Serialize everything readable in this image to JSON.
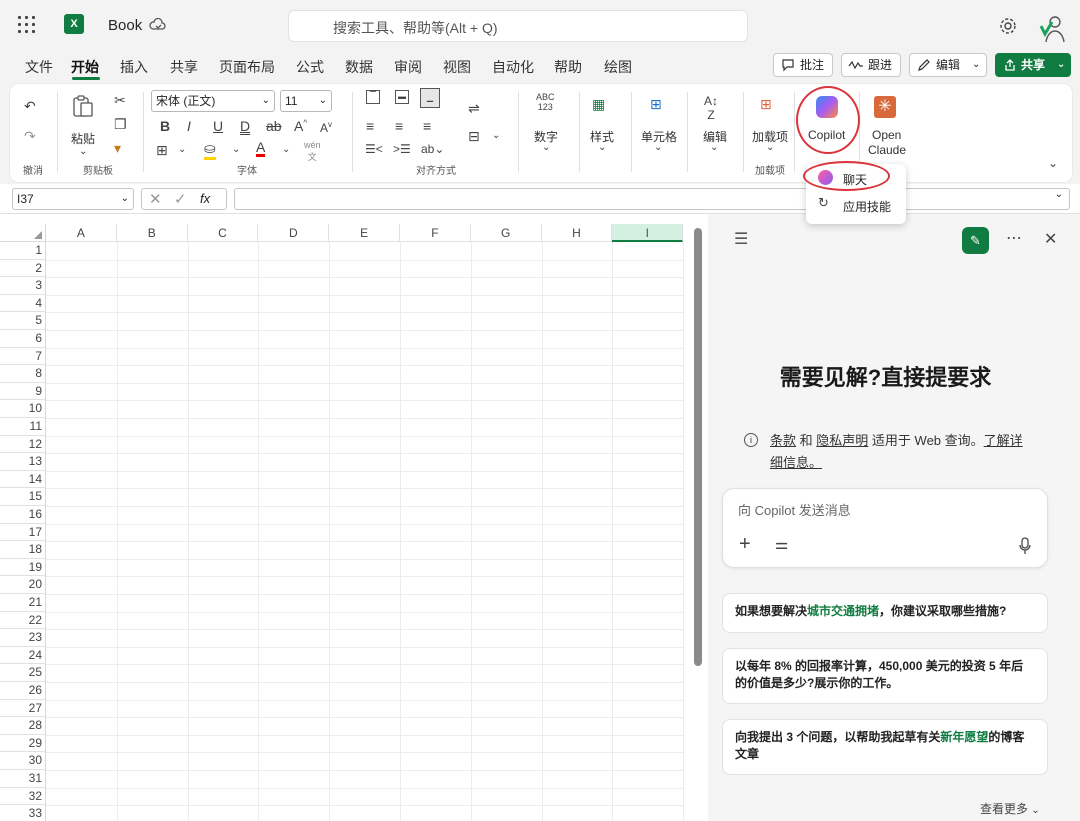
{
  "app": {
    "title": "Book",
    "search_placeholder": "搜索工具、帮助等(Alt + Q)"
  },
  "menu": {
    "tabs": [
      "文件",
      "开始",
      "插入",
      "共享",
      "页面布局",
      "公式",
      "数据",
      "审阅",
      "视图",
      "自动化",
      "帮助",
      "绘图"
    ],
    "active": "开始",
    "comments": "批注",
    "track": "跟进",
    "edit": "编辑",
    "share": "共享"
  },
  "ribbon": {
    "undo_group": "撤消",
    "paste": "粘贴",
    "clipboard_group": "剪贴板",
    "font_name": "宋体 (正文)",
    "font_size": "11",
    "font_group": "字体",
    "align_group": "对齐方式",
    "number_abc": "ABC",
    "number_123": "123",
    "number": "数字",
    "styles": "样式",
    "cells": "单元格",
    "editing": "编辑",
    "addins": "加载项",
    "addins_group": "加载项",
    "copilot": "Copilot",
    "open_claude_1": "Open",
    "open_claude_2": "Claude"
  },
  "dropdown": {
    "chat": "聊天",
    "apply_skill": "应用技能"
  },
  "formula": {
    "namebox": "I37",
    "fx": "fx"
  },
  "grid": {
    "columns": [
      "A",
      "B",
      "C",
      "D",
      "E",
      "F",
      "G",
      "H",
      "I"
    ],
    "rows": [
      "1",
      "2",
      "3",
      "4",
      "5",
      "6",
      "7",
      "8",
      "9",
      "10",
      "11",
      "12",
      "13",
      "14",
      "15",
      "16",
      "17",
      "18",
      "19",
      "20",
      "21",
      "22",
      "23",
      "24",
      "25",
      "26",
      "27",
      "28",
      "29",
      "30",
      "31",
      "32",
      "33"
    ],
    "selected_column": "I"
  },
  "copilot_pane": {
    "heading": "需要见解?直接提要求",
    "terms": "条款",
    "and": "和",
    "privacy": "隐私声明",
    "applies": "适用于 Web 查询。",
    "learn_more_1": "了解详",
    "learn_more_2": "细信息。",
    "input_placeholder": "向 Copilot 发送消息",
    "suggestions": [
      {
        "pre": "如果想要解决",
        "hl": "城市交通拥堵",
        "post": "，你建议采取哪些措施?"
      },
      {
        "pre": "以每年 8% 的回报率计算，450,000 美元的投资 5 年后的价值是多少?展示你的工作。",
        "hl": "",
        "post": ""
      },
      {
        "pre": "向我提出 3 个问题，以帮助我起草有关",
        "hl": "新年愿望",
        "post": "的博客文章"
      }
    ],
    "see_more": "查看更多"
  },
  "colors": {
    "accent": "#107c41",
    "highlight_ring": "#d9353b"
  }
}
